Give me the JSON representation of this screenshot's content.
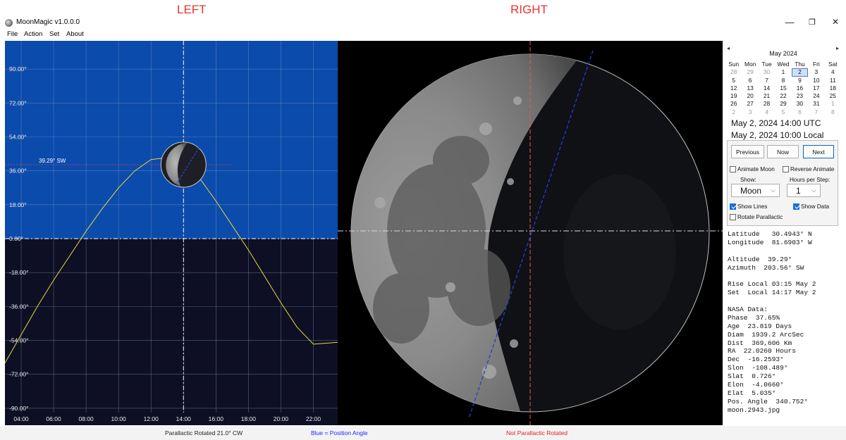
{
  "annotations": {
    "left": "LEFT",
    "right": "RIGHT"
  },
  "window": {
    "title": "MoonMagic  v1.0.0.0",
    "min": "—",
    "restore": "❐",
    "close": "✕"
  },
  "menu": [
    "File",
    "Action",
    "Set",
    "About"
  ],
  "chart_data": {
    "type": "line",
    "title": "",
    "xlabel": "",
    "ylabel": "",
    "x_ticks": [
      "04:00",
      "06:00",
      "08:00",
      "10:00",
      "12:00",
      "14:00",
      "16:00",
      "18:00",
      "20:00",
      "22:00"
    ],
    "y_ticks": [
      "90.00°",
      "72.00°",
      "54.00°",
      "36.00°",
      "18.00°",
      "0.00°",
      "-18.00°",
      "-36.00°",
      "-54.00°",
      "-72.00°",
      "-90.00°"
    ],
    "xlim": [
      3,
      23.5
    ],
    "ylim": [
      -99,
      105
    ],
    "series": [
      {
        "x": [
          3,
          4,
          5,
          6,
          7,
          8,
          9,
          10,
          11,
          12,
          13,
          14,
          15,
          16,
          17,
          18,
          19,
          20,
          21,
          22,
          23.5
        ],
        "y": [
          -66,
          -51,
          -36,
          -22,
          -9,
          4,
          16,
          27,
          36,
          42,
          43,
          40,
          32,
          20,
          7,
          -6,
          -20,
          -34,
          -47,
          -56,
          -55
        ]
      }
    ],
    "current": {
      "time": 14,
      "altitude": 39.29,
      "label": "39.29° SW"
    },
    "colors": {
      "above": "#0b4bac",
      "below": "#0e0f24",
      "curve": "#e4dc3a",
      "hline": "#e0413a",
      "grid": "#8ea3c4"
    }
  },
  "moon_view": {
    "colors": {
      "center_v": "#e85a5a",
      "position_angle": "#1f3fd6",
      "horizon": "#d8d8d8"
    },
    "position_angle_deg": 340.752
  },
  "status": {
    "left": "Parallactic Rotated 21.0° CW",
    "middle": "Blue = Position Angle",
    "right": "Not Parallactic Rotated",
    "colors": {
      "middle": "#1a2cff",
      "right": "#e22020"
    }
  },
  "calendar": {
    "prev": "◂",
    "next": "▸",
    "month": "May 2024",
    "headers": [
      "Sun",
      "Mon",
      "Tue",
      "Wed",
      "Thu",
      "Fri",
      "Sat"
    ],
    "days": [
      [
        "28",
        "dim"
      ],
      [
        "29",
        "dim"
      ],
      [
        "30",
        "dim"
      ],
      [
        "1",
        ""
      ],
      [
        "2",
        "sel"
      ],
      [
        "3",
        ""
      ],
      [
        "4",
        ""
      ],
      [
        "5",
        ""
      ],
      [
        "6",
        ""
      ],
      [
        "7",
        ""
      ],
      [
        "8",
        ""
      ],
      [
        "9",
        ""
      ],
      [
        "10",
        ""
      ],
      [
        "11",
        ""
      ],
      [
        "12",
        ""
      ],
      [
        "13",
        ""
      ],
      [
        "14",
        ""
      ],
      [
        "15",
        ""
      ],
      [
        "16",
        ""
      ],
      [
        "17",
        ""
      ],
      [
        "18",
        ""
      ],
      [
        "19",
        ""
      ],
      [
        "20",
        ""
      ],
      [
        "21",
        ""
      ],
      [
        "22",
        ""
      ],
      [
        "23",
        ""
      ],
      [
        "24",
        ""
      ],
      [
        "25",
        ""
      ],
      [
        "26",
        ""
      ],
      [
        "27",
        ""
      ],
      [
        "28",
        ""
      ],
      [
        "29",
        ""
      ],
      [
        "30",
        ""
      ],
      [
        "31",
        ""
      ],
      [
        "1",
        "dim"
      ],
      [
        "2",
        "dim"
      ],
      [
        "3",
        "dim"
      ],
      [
        "4",
        "dim"
      ],
      [
        "5",
        "dim"
      ],
      [
        "6",
        "dim"
      ],
      [
        "7",
        "dim"
      ],
      [
        "8",
        "dim"
      ]
    ]
  },
  "datetime": {
    "utc": "May 2, 2024  14:00  UTC",
    "local": "May 2, 2024  10:00  Local"
  },
  "controls": {
    "previous": "Previous",
    "now": "Now",
    "next": "Next",
    "animate_moon": "Animate Moon",
    "reverse_animate": "Reverse Animate",
    "show_label": "Show:",
    "show_value": "Moon",
    "hours_label": "Hours per Step:",
    "hours_value": "1",
    "show_lines": "Show Lines",
    "show_data": "Show Data",
    "rotate_parallactic": "Rotate Parallactic",
    "chevron": "⌵"
  },
  "data_lines": [
    "Latitude   30.4943° N",
    "Longitude  81.6903° W",
    "",
    "Altitude  39.29°",
    "Azimuth  203.56° SW",
    "",
    "Rise Local 03:15 May 2",
    "Set  Local 14:17 May 2",
    "",
    "NASA Data:",
    "Phase  37.65%",
    "Age  23.819 Days",
    "Diam  1939.2 ArcSec",
    "Dist  369,606 Km",
    "RA  22.0260 Hours",
    "Dec  -16.2593°",
    "Slon  -108.489°",
    "Slat  0.726°",
    "Elon  -4.0660°",
    "Elat  5.035°",
    "Pos. Angle  340.752°",
    "moon.2943.jpg"
  ]
}
